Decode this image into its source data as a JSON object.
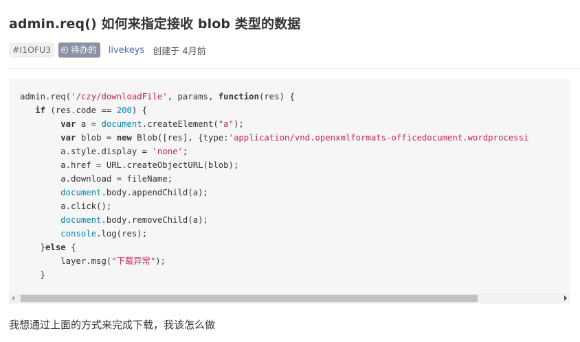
{
  "issue": {
    "title": "admin.req() 如何来指定接收 blob 类型的数据",
    "id": "#I1OFU3",
    "status": "待办的",
    "author": "livekeys",
    "created": "创建于 4月前",
    "body": "我想通过上面的方式来完成下载，我该怎么做"
  },
  "code_lines": [
    [
      {
        "t": "admin.req(",
        "c": ""
      },
      {
        "t": "'/czy/downloadFile'",
        "c": "str"
      },
      {
        "t": ", params, ",
        "c": ""
      },
      {
        "t": "function",
        "c": "kw"
      },
      {
        "t": "(res) {",
        "c": ""
      }
    ],
    [
      {
        "t": "   ",
        "c": ""
      },
      {
        "t": "if",
        "c": "kw"
      },
      {
        "t": " (res.code == ",
        "c": ""
      },
      {
        "t": "200",
        "c": "num"
      },
      {
        "t": ") {",
        "c": ""
      }
    ],
    [
      {
        "t": "        ",
        "c": ""
      },
      {
        "t": "var",
        "c": "kw"
      },
      {
        "t": " a = ",
        "c": ""
      },
      {
        "t": "document",
        "c": "glb"
      },
      {
        "t": ".createElement(",
        "c": ""
      },
      {
        "t": "\"a\"",
        "c": "str"
      },
      {
        "t": ");",
        "c": ""
      }
    ],
    [
      {
        "t": "        ",
        "c": ""
      },
      {
        "t": "var",
        "c": "kw"
      },
      {
        "t": " blob = ",
        "c": ""
      },
      {
        "t": "new",
        "c": "kw"
      },
      {
        "t": " Blob([res], {type:",
        "c": ""
      },
      {
        "t": "'application/vnd.openxmlformats-officedocument.wordprocessi",
        "c": "str"
      }
    ],
    [
      {
        "t": "        a.style.display = ",
        "c": ""
      },
      {
        "t": "'none'",
        "c": "str"
      },
      {
        "t": ";",
        "c": ""
      }
    ],
    [
      {
        "t": "        a.href = URL.createObjectURL(blob);",
        "c": ""
      }
    ],
    [
      {
        "t": "        a.download = fileName;",
        "c": ""
      }
    ],
    [
      {
        "t": "        ",
        "c": ""
      },
      {
        "t": "document",
        "c": "glb"
      },
      {
        "t": ".body.appendChild(a);",
        "c": ""
      }
    ],
    [
      {
        "t": "        a.click();",
        "c": ""
      }
    ],
    [
      {
        "t": "        ",
        "c": ""
      },
      {
        "t": "document",
        "c": "glb"
      },
      {
        "t": ".body.removeChild(a);",
        "c": ""
      }
    ],
    [
      {
        "t": "        ",
        "c": ""
      },
      {
        "t": "console",
        "c": "glb"
      },
      {
        "t": ".log(res);",
        "c": ""
      }
    ],
    [
      {
        "t": "    }",
        "c": ""
      },
      {
        "t": "else",
        "c": "kw"
      },
      {
        "t": " {",
        "c": ""
      }
    ],
    [
      {
        "t": "        layer.msg(",
        "c": ""
      },
      {
        "t": "\"下载异常\"",
        "c": "str"
      },
      {
        "t": ");",
        "c": ""
      }
    ],
    [
      {
        "t": "    }",
        "c": ""
      }
    ]
  ],
  "scroll_position": 0.0,
  "colors": {
    "status_bg": "#8c92a4",
    "link": "#4a6da7",
    "string": "#c7254e",
    "number": "#0086b3"
  }
}
